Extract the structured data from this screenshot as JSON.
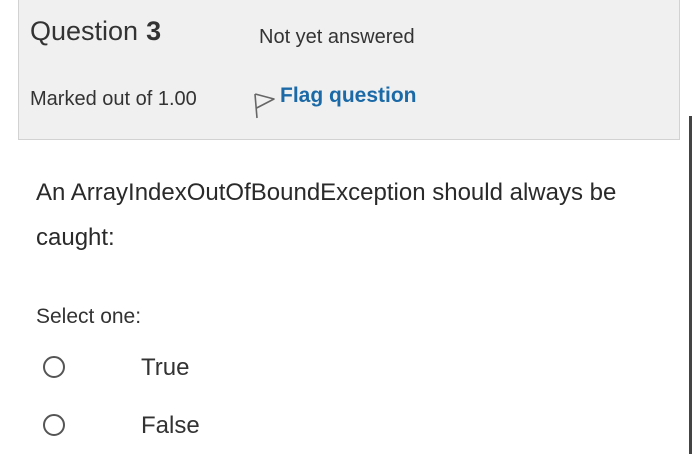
{
  "question_info": {
    "title_prefix": "Question",
    "number": "3",
    "state": "Not yet answered",
    "grade": "Marked out of 1.00",
    "flag_label": "Flag question",
    "flag_icon": "flag-outline-icon"
  },
  "question": {
    "text": "An ArrayIndexOutOfBoundException should always be caught:",
    "prompt": "Select one:",
    "options": [
      {
        "label": "True",
        "selected": false
      },
      {
        "label": "False",
        "selected": false
      }
    ]
  },
  "colors": {
    "info_background": "#f0f0f0",
    "link": "#1b6aa7",
    "text": "#333333"
  }
}
